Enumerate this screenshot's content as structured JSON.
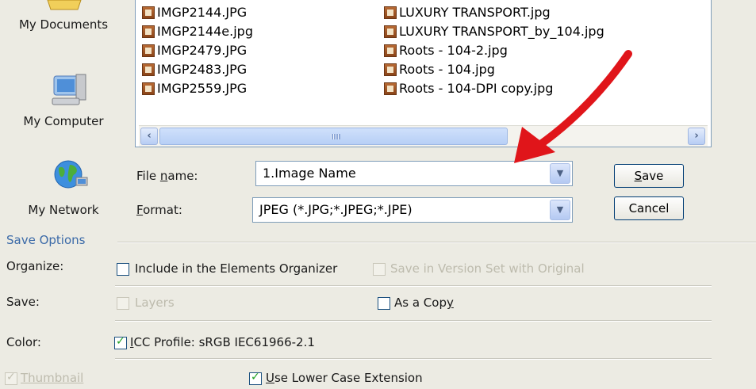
{
  "places": {
    "my_documents": "My Documents",
    "my_computer": "My Computer",
    "my_network": "My Network"
  },
  "files": {
    "left": [
      "IMGP2144.JPG",
      "IMGP2144e.jpg",
      "IMGP2479.JPG",
      "IMGP2483.JPG",
      "IMGP2559.JPG"
    ],
    "right": [
      "LUXURY TRANSPORT.jpg",
      "LUXURY TRANSPORT_by_104.jpg",
      "Roots - 104-2.jpg",
      "Roots - 104.jpg",
      "Roots - 104-DPI copy.jpg"
    ]
  },
  "form": {
    "file_name_label_prefix": "File ",
    "file_name_label_ul": "n",
    "file_name_label_suffix": "ame:",
    "file_name_value": "1.Image Name",
    "format_label_ul": "F",
    "format_label_suffix": "ormat:",
    "format_value": "JPEG (*.JPG;*.JPEG;*.JPE)",
    "save_button_ul": "S",
    "save_button_suffix": "ave",
    "cancel_button": "Cancel"
  },
  "save_options": {
    "title": "Save Options",
    "organize_label": "Organize:",
    "include_organizer": "Include in the Elements Organizer",
    "version_set": "Save in Version Set with Original",
    "save_label": "Save:",
    "layers": "Layers",
    "as_copy_prefix": "As a Cop",
    "as_copy_ul": "y",
    "color_label": "Color:",
    "icc_ul": "I",
    "icc_suffix": "CC Profile:  sRGB IEC61966-2.1",
    "thumbnail": "Thumbnail",
    "lowercase_ul": "U",
    "lowercase_suffix": "se Lower Case Extension"
  },
  "colors": {
    "arrow": "#e0151a",
    "accent_blue": "#3b6aa8",
    "check_green": "#21a121"
  }
}
